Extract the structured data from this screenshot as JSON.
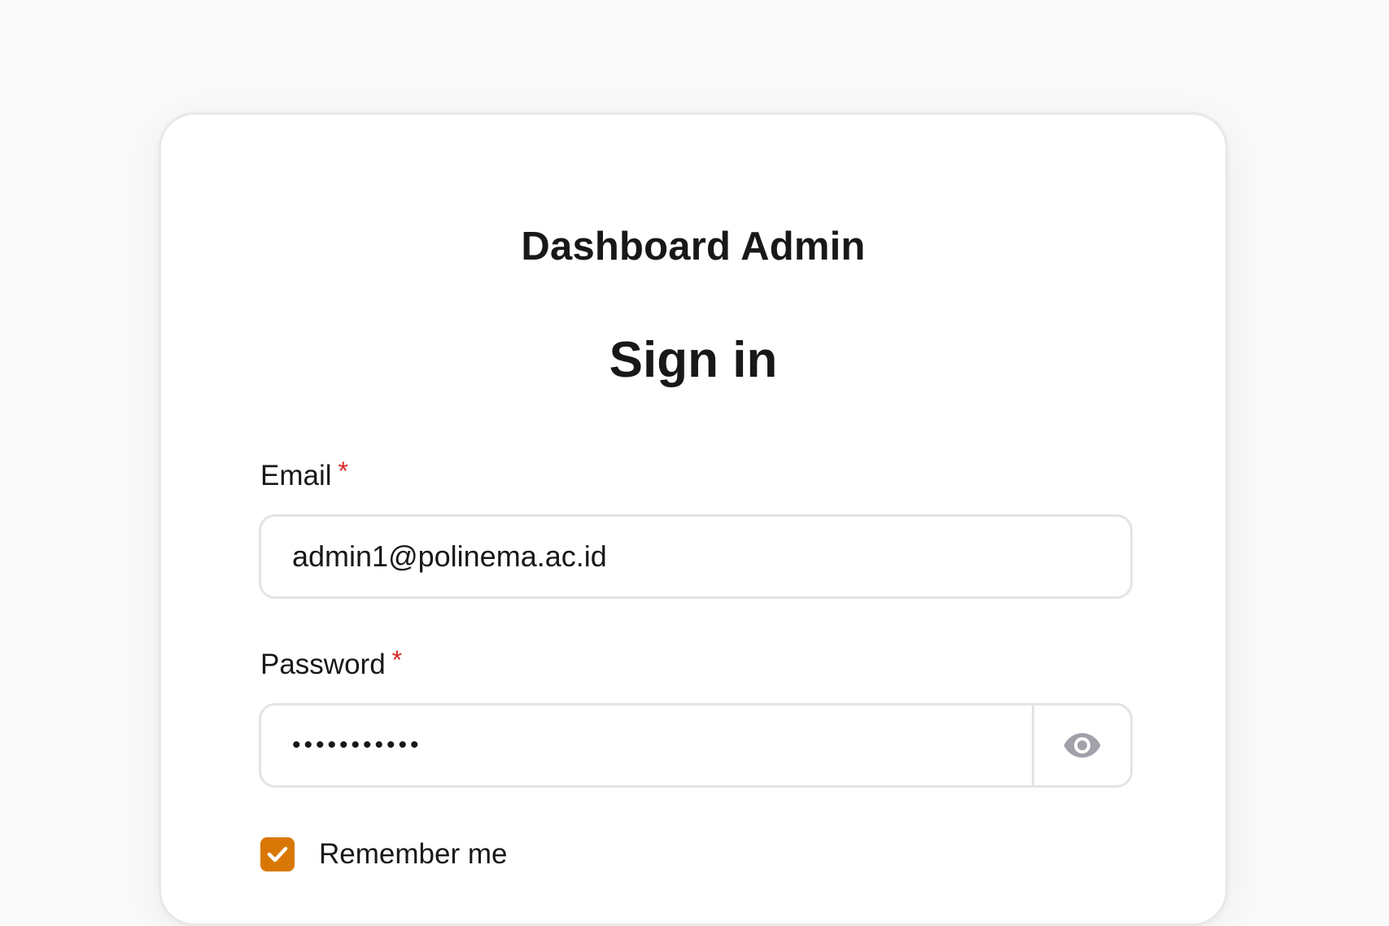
{
  "brand": {
    "title": "Dashboard Admin"
  },
  "form": {
    "heading": "Sign in",
    "email": {
      "label": "Email",
      "required_marker": "*",
      "value": "admin1@polinema.ac.id"
    },
    "password": {
      "label": "Password",
      "required_marker": "*",
      "masked_value": "•••••••••••",
      "toggle_icon": "eye-icon"
    },
    "remember": {
      "label": "Remember me",
      "checked": true
    }
  },
  "colors": {
    "accent": "#d97706",
    "required": "#dc2626",
    "text": "#18181b",
    "border": "#e4e4e7",
    "icon": "#a1a1aa"
  }
}
